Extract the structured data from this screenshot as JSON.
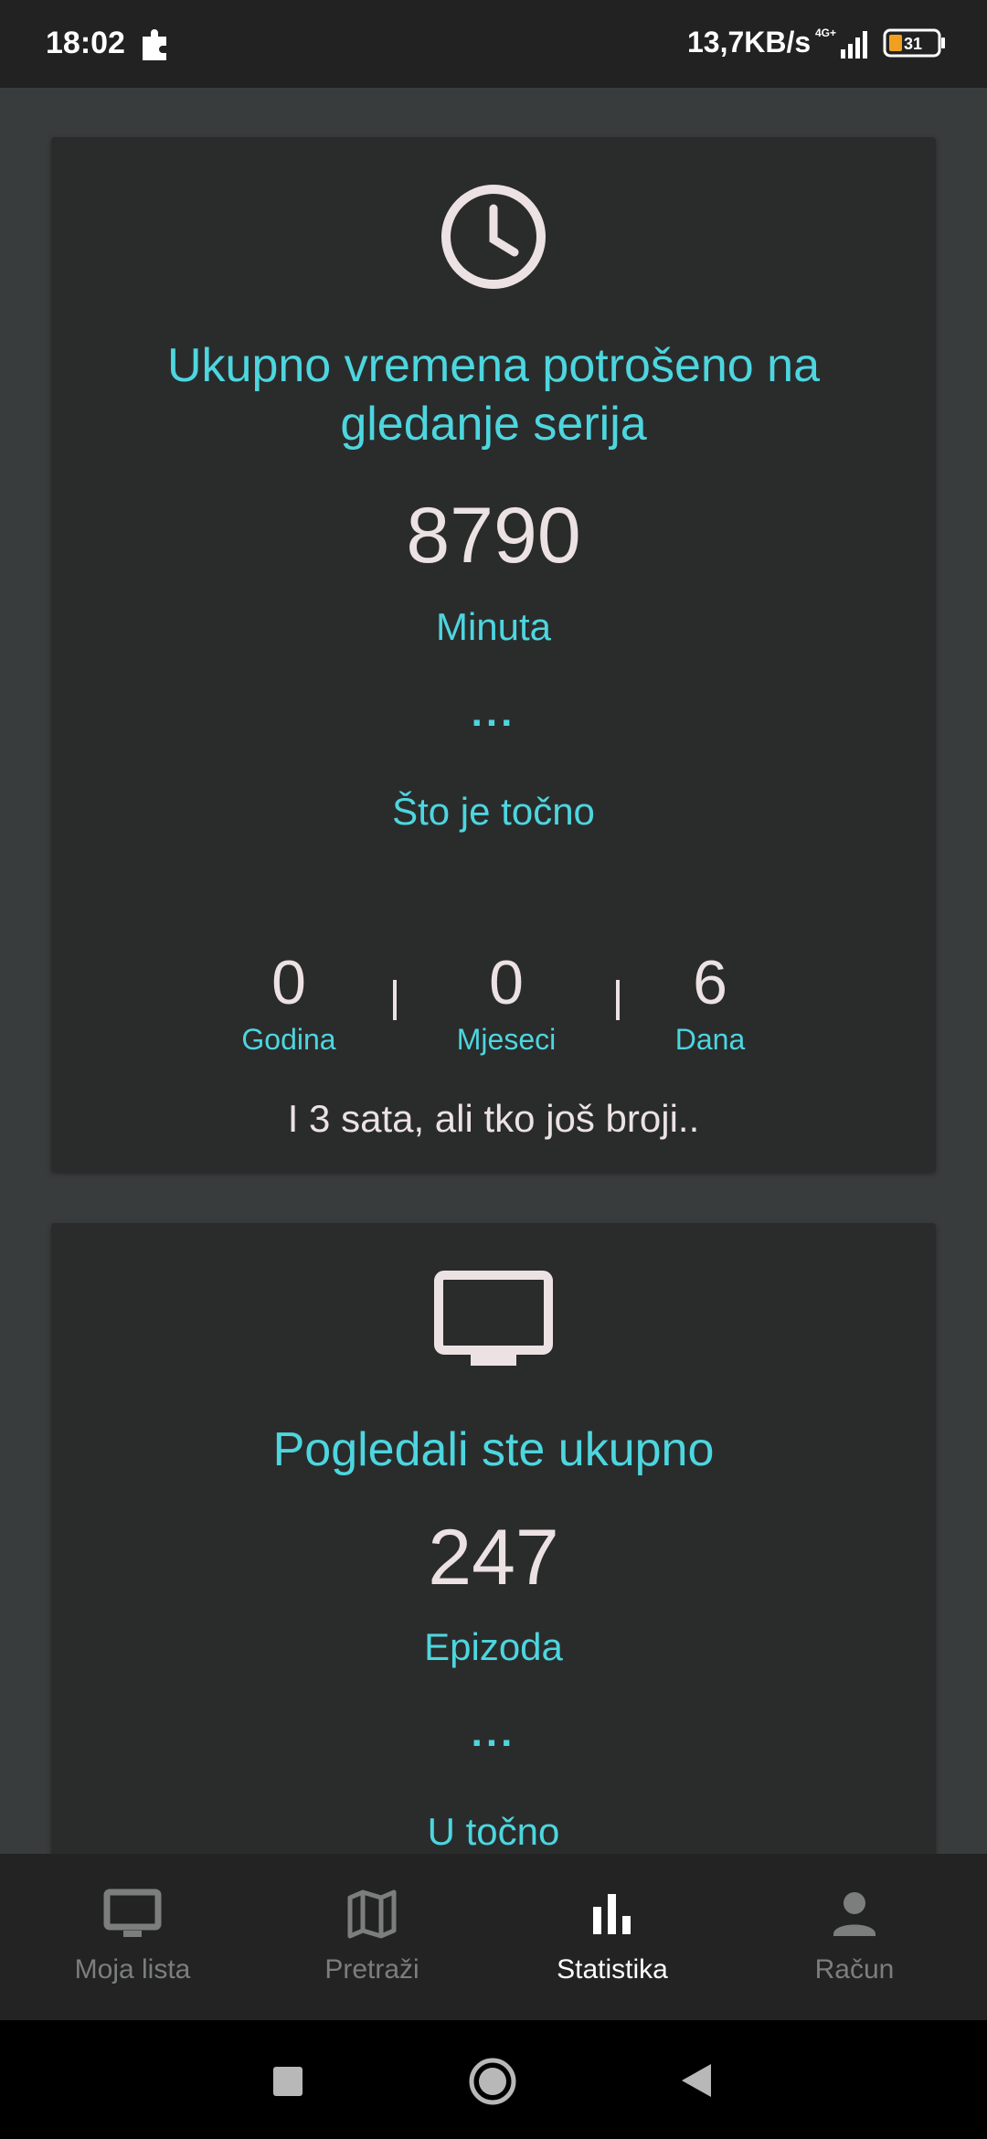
{
  "status_bar": {
    "time": "18:02",
    "speed": "13,7KB/s",
    "network": "4G+",
    "battery": "31"
  },
  "watch_time_card": {
    "icon": "clock-icon",
    "title_line1": "Ukupno vremena potrošeno na",
    "title_line2": "gledanje serija",
    "total_value": "8790",
    "total_unit": "Minuta",
    "ellipsis": "...",
    "exact_label": "Što je točno",
    "breakdown": [
      {
        "value": "0",
        "label": "Godina"
      },
      {
        "value": "0",
        "label": "Mjeseci"
      },
      {
        "value": "6",
        "label": "Dana"
      }
    ],
    "remainder": "I 3 sata, ali tko još broji.."
  },
  "episodes_card": {
    "icon": "tv-icon",
    "title": "Pogledali ste ukupno",
    "total_value": "247",
    "total_unit": "Epizoda",
    "ellipsis": "...",
    "exact_label": "U točno"
  },
  "bottom_nav": {
    "items": [
      {
        "label": "Moja lista",
        "icon": "tv-icon",
        "active": false
      },
      {
        "label": "Pretraži",
        "icon": "map-icon",
        "active": false
      },
      {
        "label": "Statistika",
        "icon": "bar-chart-icon",
        "active": true
      },
      {
        "label": "Račun",
        "icon": "person-icon",
        "active": false
      }
    ]
  },
  "colors": {
    "accent": "#4dd6df",
    "text_light": "#ece2e3",
    "background": "#383c3c",
    "card": "#2a2c2c",
    "nav_inactive": "#7c7e7e"
  }
}
